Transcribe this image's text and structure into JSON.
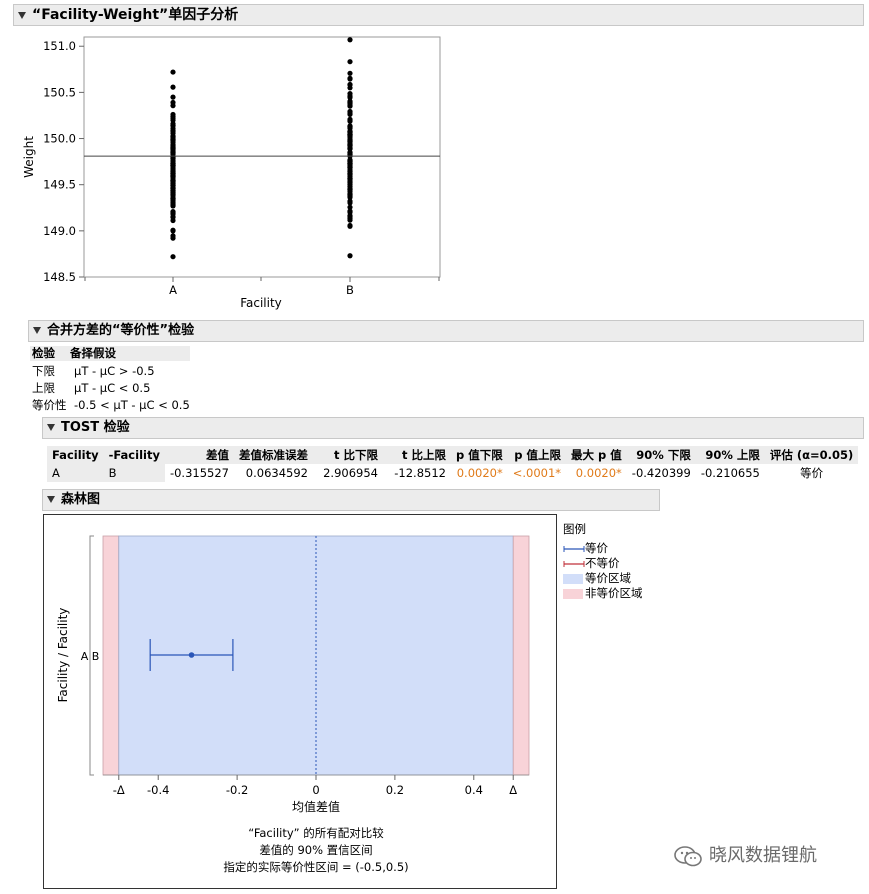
{
  "oneway": {
    "title": "“Facility-Weight”单因子分析",
    "ylabel": "Weight",
    "xlabel": "Facility",
    "categories": [
      "A",
      "B"
    ],
    "y_ticks": [
      "151.0",
      "150.5",
      "150.0",
      "149.5",
      "149.0",
      "148.5"
    ],
    "ylim": [
      148.5,
      151.1
    ],
    "grand_mean": 149.81
  },
  "equivalence": {
    "title": "合并方差的“等价性”检验",
    "hyp_headers": [
      "检验",
      "备择假设"
    ],
    "hyp_rows": [
      [
        "下限",
        "μT - μC > -0.5"
      ],
      [
        "上限",
        "μT - μC < 0.5"
      ],
      [
        "等价性",
        "-0.5 < μT - μC < 0.5"
      ]
    ]
  },
  "tost": {
    "title": "TOST 检验",
    "headers": [
      "Facility",
      "-Facility",
      "差值",
      "差值标准误差",
      "t 比下限",
      "t 比上限",
      "p 值下限",
      "p 值上限",
      "最大 p 值",
      "90% 下限",
      "90% 上限",
      "评估 (α=0.05)"
    ],
    "row": [
      "A",
      "B",
      "-0.315527",
      "0.0634592",
      "2.906954",
      "-12.8512",
      "0.0020*",
      "<.0001*",
      "0.0020*",
      "-0.420399",
      "-0.210655",
      "等价"
    ]
  },
  "forest": {
    "title": "森林图",
    "ylabel": "Facility / Facility",
    "row_label": "A B",
    "xlabel": "均值差值",
    "x_ticks": [
      "-Δ",
      "-0.4",
      "-0.2",
      "0",
      "0.2",
      "0.4",
      "Δ"
    ],
    "caption1": "“Facility” 的所有配对比较",
    "caption2": "差值的 90% 置信区间",
    "caption3": "指定的实际等价性区间 = (-0.5,0.5)",
    "estimate": -0.315527,
    "ci": [
      -0.420399,
      -0.210655
    ],
    "margin": 0.5,
    "legend_title": "图例",
    "legend": [
      "等价",
      "不等价",
      "等价区域",
      "非等价区域"
    ],
    "colors": {
      "equiv_region": "#d2def9",
      "nonequiv_region": "#f8d3d8",
      "ci_line": "#2a56b8"
    }
  },
  "watermark": "晓风数据锂航"
}
